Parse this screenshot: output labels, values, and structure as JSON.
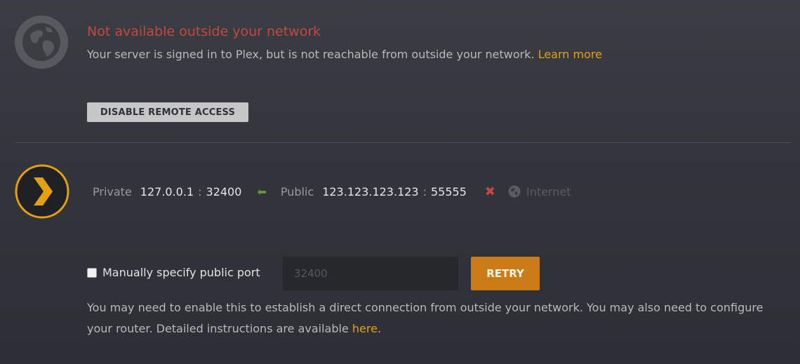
{
  "status": {
    "title": "Not available outside your network",
    "description": "Your server is signed in to Plex, but is not reachable from outside your network.",
    "learn_more_label": "Learn more"
  },
  "actions": {
    "disable_remote_label": "DISABLE REMOTE ACCESS"
  },
  "connection": {
    "private_label": "Private",
    "private_ip": "127.0.0.1",
    "private_port": "32400",
    "separator": ":",
    "public_label": "Public",
    "public_ip": "123.123.123.123",
    "public_port": "55555",
    "internet_label": "Internet"
  },
  "manual_port": {
    "checkbox_label": "Manually specify public port",
    "checked": false,
    "placeholder": "32400",
    "retry_label": "RETRY"
  },
  "help": {
    "text": "You may need to enable this to establish a direct connection from outside your network. You may also need to configure your router. Detailed instructions are available",
    "link_label": "here",
    "trailing": "."
  },
  "colors": {
    "error": "#c4483f",
    "accent": "#e5a00d",
    "retry": "#cc7b19",
    "ok_arrow": "#5a9a3a"
  },
  "icons": {
    "status": "globe-icon",
    "server": "plex-chevron-icon",
    "arrow": "arrow-left-icon",
    "fail": "x-icon",
    "internet": "globe-small-icon"
  }
}
